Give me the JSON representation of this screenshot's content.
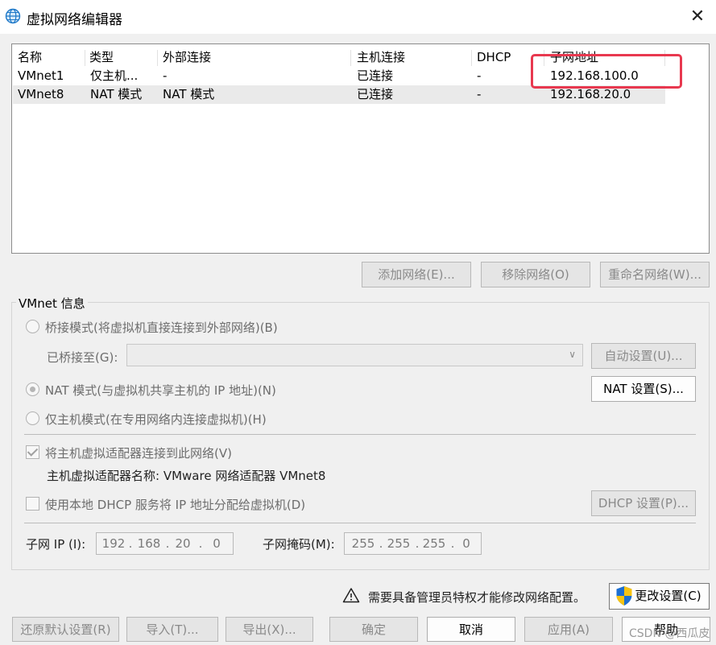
{
  "window": {
    "title": "虚拟网络编辑器",
    "close": "✕"
  },
  "columns": [
    "名称",
    "类型",
    "外部连接",
    "主机连接",
    "DHCP",
    "子网地址"
  ],
  "rows": [
    [
      "VMnet1",
      "仅主机...",
      "-",
      "已连接",
      "-",
      "192.168.100.0"
    ],
    [
      "VMnet8",
      "NAT 模式",
      "NAT 模式",
      "已连接",
      "-",
      "192.168.20.0"
    ]
  ],
  "list_buttons": {
    "add": "添加网络(E)...",
    "remove": "移除网络(O)",
    "rename": "重命名网络(W)..."
  },
  "vmnet_info": {
    "title": "VMnet 信息",
    "bridge_label": "桥接模式(将虚拟机直接连接到外部网络)(B)",
    "bridged_to_label": "已桥接至(G):",
    "auto_settings": "自动设置(U)...",
    "nat_label": "NAT 模式(与虚拟机共享主机的 IP 地址)(N)",
    "nat_settings": "NAT 设置(S)...",
    "hostonly_label": "仅主机模式(在专用网络内连接虚拟机)(H)",
    "connect_adapter_label": "将主机虚拟适配器连接到此网络(V)",
    "adapter_name": "主机虚拟适配器名称: VMware 网络适配器 VMnet8",
    "dhcp_label": "使用本地 DHCP 服务将 IP 地址分配给虚拟机(D)",
    "dhcp_settings": "DHCP 设置(P)...",
    "subnet_ip_label": "子网 IP (I):",
    "subnet_ip": [
      "192",
      "168",
      "20",
      "0"
    ],
    "subnet_mask_label": "子网掩码(M):",
    "subnet_mask": [
      "255",
      "255",
      "255",
      "0"
    ]
  },
  "admin_notice": "需要具备管理员特权才能修改网络配置。",
  "change_settings": "更改设置(C)",
  "bottom_buttons": {
    "restore": "还原默认设置(R)",
    "import": "导入(T)...",
    "export": "导出(X)...",
    "ok": "确定",
    "cancel": "取消",
    "apply": "应用(A)",
    "help": "帮助"
  },
  "watermark": "CSDN @西瓜皮",
  "colors": {
    "highlight": "#e8384f",
    "shield_blue": "#1d6fd1",
    "shield_yellow": "#f6c313"
  }
}
